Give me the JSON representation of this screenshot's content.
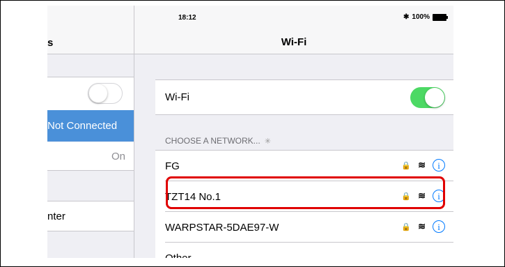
{
  "status_bar": {
    "time": "18:12",
    "bluetooth_icon": "bluetooth-icon",
    "battery": "100%"
  },
  "left_pane": {
    "nav_title": "s",
    "wifi_toggle_on": false,
    "wifi_status": "Not Connected",
    "bluetooth_value": "On",
    "notification_center": "nter"
  },
  "right_pane": {
    "nav_title": "Wi-Fi",
    "wifi_label": "Wi-Fi",
    "wifi_toggle_on": true,
    "section_header": "CHOOSE A NETWORK...",
    "networks": [
      {
        "name": "FG",
        "secured": true
      },
      {
        "name": "TZT14 No.1",
        "secured": true,
        "highlighted": true
      },
      {
        "name": "WARPSTAR-5DAE97-W",
        "secured": true
      },
      {
        "name": "Other...",
        "secured": false
      }
    ]
  },
  "colors": {
    "toggle_on": "#4cd964",
    "selected_row": "#4a90d9",
    "info_blue": "#007aff",
    "highlight_border": "#e00000"
  }
}
